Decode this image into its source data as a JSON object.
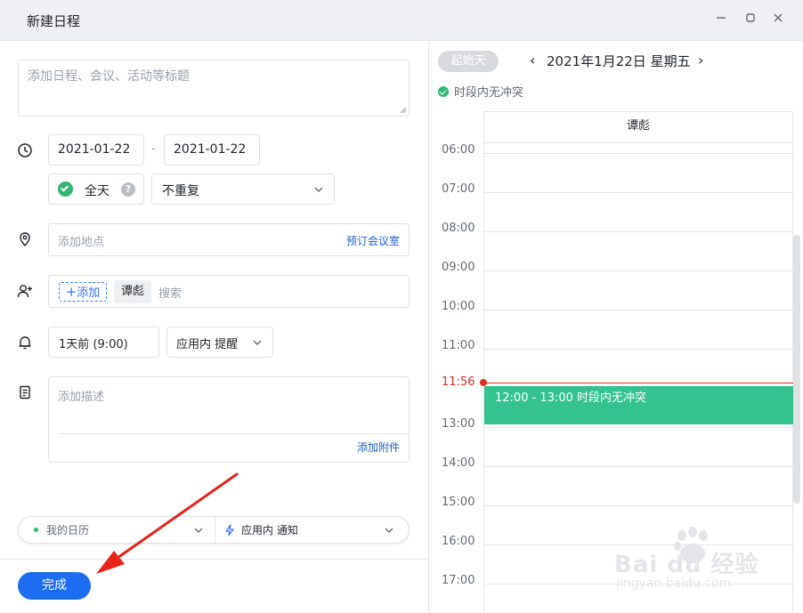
{
  "window": {
    "title": "新建日程",
    "controls": [
      "minimize",
      "maximize",
      "close"
    ]
  },
  "form": {
    "title_placeholder": "添加日程、会议、活动等标题",
    "start_date": "2021-01-22",
    "date_separator": "-",
    "end_date": "2021-01-22",
    "all_day_label": "全天",
    "all_day_checked": true,
    "help_glyph": "?",
    "repeat_value": "不重复",
    "location_placeholder": "添加地点",
    "book_room_link": "预订会议室",
    "add_attendee_label": "添加",
    "attendee": "谭彪",
    "attendee_search_placeholder": "搜索",
    "reminder_value": "1天前 (9:00)",
    "reminder_type": "应用内 提醒",
    "description_placeholder": "添加描述",
    "add_attachment_link": "添加附件",
    "calendar_value": "我的日历",
    "notify_value": "应用内 通知",
    "done_button": "完成",
    "accent_color": "#1d6df2"
  },
  "calendar": {
    "start_day_button": "起始天",
    "prev_glyph": "‹",
    "next_glyph": "›",
    "date_title": "2021年1月22日 星期五",
    "conflict_status": "时段内无冲突",
    "column_header": "谭彪",
    "hours": [
      "06:00",
      "07:00",
      "08:00",
      "09:00",
      "10:00",
      "11:00",
      "13:00",
      "14:00",
      "15:00",
      "16:00",
      "17:00"
    ],
    "now_label": "11:56",
    "event_text": "12:00 - 13:00 时段内无冲突",
    "event_color": "#34c38f",
    "now_color": "#e22d21"
  },
  "watermark": {
    "brand": "Bai du 经验",
    "url": "jingyan.baidu.com"
  }
}
